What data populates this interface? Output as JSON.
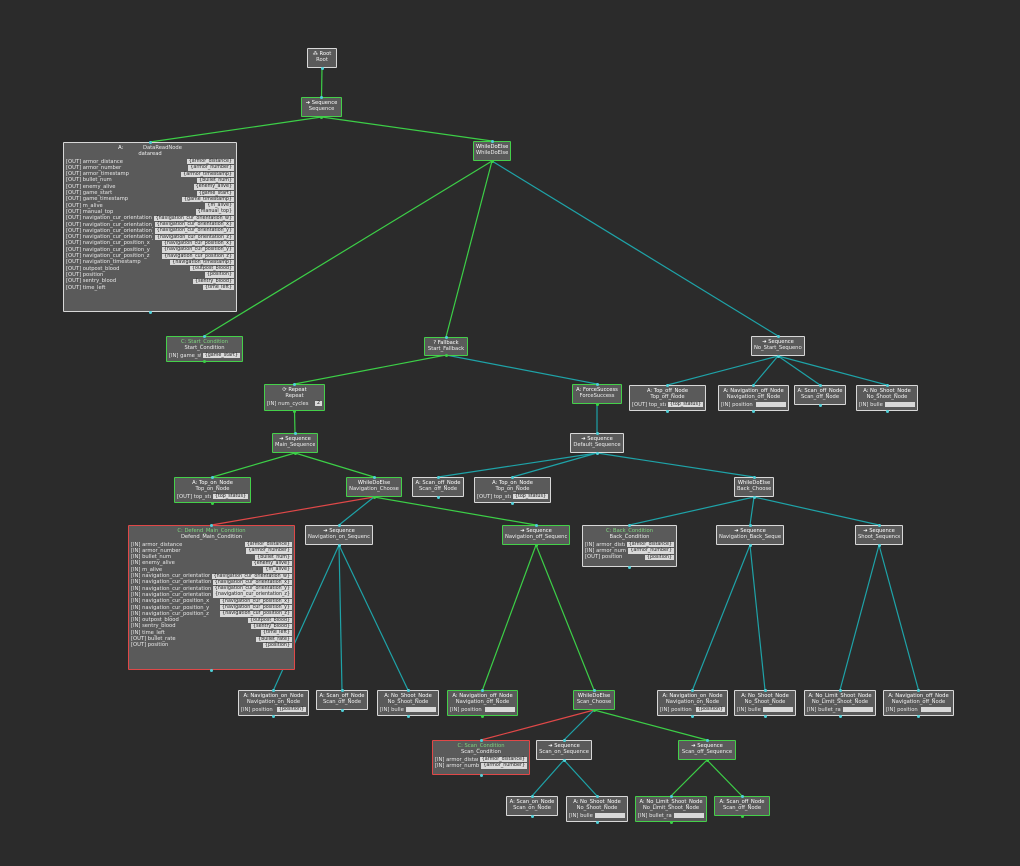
{
  "colors": {
    "background": "#2b2b2b",
    "green_edge": "#3ccf47",
    "teal_edge": "#1ea3a8",
    "red_edge": "#e04848",
    "node_fill": "#5a5a5a"
  },
  "nodes": {
    "root": {
      "kind": "Root",
      "icon": "tree-icon",
      "name": "Root",
      "ports": []
    },
    "sequence": {
      "kind": "Sequence",
      "icon": "arrow-right-icon",
      "name": "Sequence",
      "ports": []
    },
    "dataread": {
      "kind": "A:",
      "title": "DataReadNode",
      "name": "dataread",
      "ports": [
        {
          "dir": "[OUT]",
          "name": "armor_distance",
          "value": "{armor_distance}"
        },
        {
          "dir": "[OUT]",
          "name": "armor_number",
          "value": "{armor_number}"
        },
        {
          "dir": "[OUT]",
          "name": "armor_timestamp",
          "value": "{armor_timestamp}"
        },
        {
          "dir": "[OUT]",
          "name": "bullet_num",
          "value": "{bullet_num}"
        },
        {
          "dir": "[OUT]",
          "name": "enemy_alive",
          "value": "{enemy_alive}"
        },
        {
          "dir": "[OUT]",
          "name": "game_start",
          "value": "{game_start}"
        },
        {
          "dir": "[OUT]",
          "name": "game_timestamp",
          "value": "{game_timestamp}"
        },
        {
          "dir": "[OUT]",
          "name": "m_alive",
          "value": "{m_alive}"
        },
        {
          "dir": "[OUT]",
          "name": "manual_top",
          "value": "{manual_top}"
        },
        {
          "dir": "[OUT]",
          "name": "navigation_cur_orientation_w",
          "value": "{navigation_cur_orientation_w}"
        },
        {
          "dir": "[OUT]",
          "name": "navigation_cur_orientation_x",
          "value": "{navigation_cur_orientation_x}"
        },
        {
          "dir": "[OUT]",
          "name": "navigation_cur_orientation_y",
          "value": "{navigation_cur_orientation_y}"
        },
        {
          "dir": "[OUT]",
          "name": "navigation_cur_orientation_z",
          "value": "{navigation_cur_orientation_z}"
        },
        {
          "dir": "[OUT]",
          "name": "navigation_cur_position_x",
          "value": "{navigation_cur_position_x}"
        },
        {
          "dir": "[OUT]",
          "name": "navigation_cur_position_y",
          "value": "{navigation_cur_position_y}"
        },
        {
          "dir": "[OUT]",
          "name": "navigation_cur_position_z",
          "value": "{navigation_cur_position_z}"
        },
        {
          "dir": "[OUT]",
          "name": "navigation_timestamp",
          "value": "{navigation_timestamp}"
        },
        {
          "dir": "[OUT]",
          "name": "outpost_blood",
          "value": "{outpost_blood}"
        },
        {
          "dir": "[OUT]",
          "name": "position",
          "value": "{position}"
        },
        {
          "dir": "[OUT]",
          "name": "sentry_blood",
          "value": "{sentry_blood}"
        },
        {
          "dir": "[OUT]",
          "name": "time_left",
          "value": "{time_left}"
        }
      ]
    },
    "whiledoelse_main": {
      "kind": "WhileDoElse",
      "name": "WhileDoElse",
      "ports": []
    },
    "start_condition": {
      "kind": "C: Start_Condition",
      "name": "Start_Condition",
      "ports": [
        {
          "dir": "[IN]",
          "name": "game_start",
          "value": "{game_start}"
        }
      ]
    },
    "start_fallback": {
      "kind": "? Fallback",
      "name": "Start_Fallback",
      "ports": []
    },
    "no_start_sequence": {
      "kind": "Sequence",
      "name": "No_Start_Sequence",
      "ports": []
    },
    "repeat": {
      "kind": "Repeat",
      "name": "Repeat",
      "ports": [
        {
          "dir": "[IN]",
          "name": "num_cycles",
          "value": "2"
        }
      ]
    },
    "forcesuccess": {
      "kind": "A: ForceSuccess",
      "name": "ForceSuccess",
      "ports": []
    },
    "top_off_node_ns": {
      "kind": "A: Top_off_Node",
      "name": "Top_off_Node",
      "ports": [
        {
          "dir": "[OUT]",
          "name": "top_status",
          "value": "{top_status}"
        }
      ]
    },
    "nav_off_node_ns": {
      "kind": "A: Navigation_off_Node",
      "name": "Navigation_off_Node",
      "ports": [
        {
          "dir": "[IN]",
          "name": "position",
          "value": ""
        }
      ]
    },
    "scan_off_node_ns": {
      "kind": "A: Scan_off_Node",
      "name": "Scan_off_Node",
      "ports": []
    },
    "no_shoot_node_ns": {
      "kind": "A: No_Shoot_Node",
      "name": "No_Shoot_Node",
      "ports": [
        {
          "dir": "[IN]",
          "name": "bullet_rate",
          "value": ""
        }
      ]
    },
    "main_sequence": {
      "kind": "Sequence",
      "name": "Main_Sequence",
      "ports": []
    },
    "default_sequence": {
      "kind": "Sequence",
      "name": "Default_Sequence",
      "ports": []
    },
    "top_on_node_main": {
      "kind": "A: Top_on_Node",
      "name": "Top_on_Node",
      "ports": [
        {
          "dir": "[OUT]",
          "name": "top_status",
          "value": "{top_status}"
        }
      ]
    },
    "navigation_choose": {
      "kind": "WhileDoElse",
      "name": "Navigation_Choose",
      "ports": []
    },
    "scan_off_node_def": {
      "kind": "A: Scan_off_Node",
      "name": "Scan_off_Node",
      "ports": []
    },
    "top_on_node_def": {
      "kind": "A: Top_on_Node",
      "name": "Top_on_Node",
      "ports": [
        {
          "dir": "[OUT]",
          "name": "top_status",
          "value": "{top_status}"
        }
      ]
    },
    "back_choose": {
      "kind": "WhileDoElse",
      "name": "Back_Choose",
      "ports": []
    },
    "defend_main_condition": {
      "kind": "C: Defend_Main_Condition",
      "name": "Defend_Main_Condition",
      "ports": [
        {
          "dir": "[IN]",
          "name": "armor_distance",
          "value": "{armor_distance}"
        },
        {
          "dir": "[IN]",
          "name": "armor_number",
          "value": "{armor_number}"
        },
        {
          "dir": "[IN]",
          "name": "bullet_num",
          "value": "{bullet_num}"
        },
        {
          "dir": "[IN]",
          "name": "enemy_alive",
          "value": "{enemy_alive}"
        },
        {
          "dir": "[IN]",
          "name": "m_alive",
          "value": "{m_alive}"
        },
        {
          "dir": "[IN]",
          "name": "navigation_cur_orientation_w",
          "value": "{navigation_cur_orientation_w}"
        },
        {
          "dir": "[IN]",
          "name": "navigation_cur_orientation_x",
          "value": "{navigation_cur_orientation_x}"
        },
        {
          "dir": "[IN]",
          "name": "navigation_cur_orientation_y",
          "value": "{navigation_cur_orientation_y}"
        },
        {
          "dir": "[IN]",
          "name": "navigation_cur_orientation_z",
          "value": "{navigation_cur_orientation_z}"
        },
        {
          "dir": "[IN]",
          "name": "navigation_cur_position_x",
          "value": "{navigation_cur_position_x}"
        },
        {
          "dir": "[IN]",
          "name": "navigation_cur_position_y",
          "value": "{navigation_cur_position_y}"
        },
        {
          "dir": "[IN]",
          "name": "navigation_cur_position_z",
          "value": "{navigation_cur_position_z}"
        },
        {
          "dir": "[IN]",
          "name": "outpost_blood",
          "value": "{outpost_blood}"
        },
        {
          "dir": "[IN]",
          "name": "sentry_blood",
          "value": "{sentry_blood}"
        },
        {
          "dir": "[IN]",
          "name": "time_left",
          "value": "{time_left}"
        },
        {
          "dir": "[OUT]",
          "name": "bullet_rate",
          "value": "{bullet_rate}"
        },
        {
          "dir": "[OUT]",
          "name": "position",
          "value": "{position}"
        }
      ]
    },
    "navigation_on_sequence": {
      "kind": "Sequence",
      "name": "Navigation_on_Sequence",
      "ports": []
    },
    "navigation_off_sequence": {
      "kind": "Sequence",
      "name": "Navigation_off_Sequence",
      "ports": []
    },
    "back_condition": {
      "kind": "C: Back_Condition",
      "name": "Back_Condition",
      "ports": [
        {
          "dir": "[IN]",
          "name": "armor_distance",
          "value": "{armor_distance}"
        },
        {
          "dir": "[IN]",
          "name": "armor_number",
          "value": "{armor_number}"
        },
        {
          "dir": "[OUT]",
          "name": "position",
          "value": "{position}"
        }
      ]
    },
    "navigation_back_sequence": {
      "kind": "Sequence",
      "name": "Navigation_Back_Sequence",
      "ports": []
    },
    "shoot_sequence": {
      "kind": "Sequence",
      "name": "Shoot_Sequence",
      "ports": []
    },
    "nav_on_node_1": {
      "kind": "A: Navigation_on_Node",
      "name": "Navigation_on_Node",
      "ports": [
        {
          "dir": "[IN]",
          "name": "position",
          "value": "{position}"
        }
      ]
    },
    "scan_off_node_1": {
      "kind": "A: Scan_off_Node",
      "name": "Scan_off_Node",
      "ports": []
    },
    "no_shoot_node_1": {
      "kind": "A: No_Shoot_Node",
      "name": "No_Shoot_Node",
      "ports": [
        {
          "dir": "[IN]",
          "name": "bullet_rate",
          "value": ""
        }
      ]
    },
    "nav_off_node_1": {
      "kind": "A: Navigation_off_Node",
      "name": "Navigation_off_Node",
      "ports": [
        {
          "dir": "[IN]",
          "name": "position",
          "value": ""
        }
      ]
    },
    "scan_choose": {
      "kind": "WhileDoElse",
      "name": "Scan_Choose",
      "ports": []
    },
    "nav_on_node_2": {
      "kind": "A: Navigation_on_Node",
      "name": "Navigation_on_Node",
      "ports": [
        {
          "dir": "[IN]",
          "name": "position",
          "value": "{position}"
        }
      ]
    },
    "no_shoot_node_2": {
      "kind": "A: No_Shoot_Node",
      "name": "No_Shoot_Node",
      "ports": [
        {
          "dir": "[IN]",
          "name": "bullet_rate",
          "value": ""
        }
      ]
    },
    "no_limit_shoot_node_1": {
      "kind": "A: No_Limit_Shoot_Node",
      "name": "No_Limit_Shoot_Node",
      "ports": [
        {
          "dir": "[IN]",
          "name": "bullet_rate",
          "value": ""
        }
      ]
    },
    "nav_off_node_2": {
      "kind": "A: Navigation_off_Node",
      "name": "Navigation_off_Node",
      "ports": [
        {
          "dir": "[IN]",
          "name": "position",
          "value": ""
        }
      ]
    },
    "scan_condition": {
      "kind": "C: Scan_Condition",
      "name": "Scan_Condition",
      "ports": [
        {
          "dir": "[IN]",
          "name": "armor_distance",
          "value": "{armor_distance}"
        },
        {
          "dir": "[IN]",
          "name": "armor_number",
          "value": "{armor_number}"
        }
      ]
    },
    "scan_on_sequence": {
      "kind": "Sequence",
      "name": "Scan_on_Sequence",
      "ports": []
    },
    "scan_off_sequence": {
      "kind": "Sequence",
      "name": "Scan_off_Sequence",
      "ports": []
    },
    "scan_on_node": {
      "kind": "A: Scan_on_Node",
      "name": "Scan_on_Node",
      "ports": []
    },
    "no_shoot_node_3": {
      "kind": "A: No_Shoot_Node",
      "name": "No_Shoot_Node",
      "ports": [
        {
          "dir": "[IN]",
          "name": "bullet_rate",
          "value": ""
        }
      ]
    },
    "no_limit_shoot_node_2": {
      "kind": "A: No_Limit_Shoot_Node",
      "name": "No_Limit_Shoot_Node",
      "ports": [
        {
          "dir": "[IN]",
          "name": "bullet_rate",
          "value": ""
        }
      ]
    },
    "scan_off_node_2": {
      "kind": "A: Scan_off_Node",
      "name": "Scan_off_Node",
      "ports": []
    }
  }
}
